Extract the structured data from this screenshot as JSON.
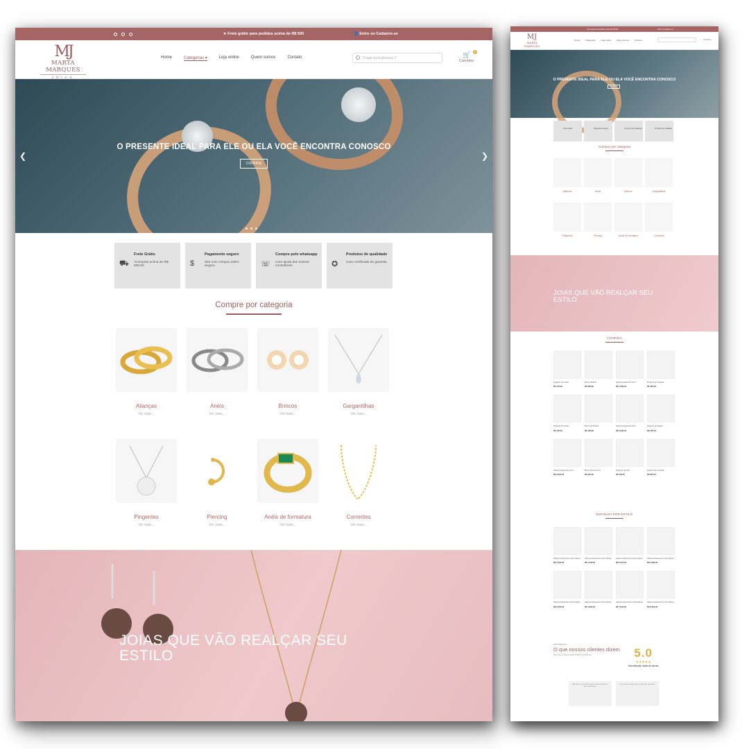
{
  "topbar": {
    "shipping": "Frete grátis para pedidos acima de R$ 500",
    "login": "Entre ou Cadastre-se"
  },
  "brand": {
    "monogram": "MJ",
    "name": "MARTA MARQUES",
    "sub": "JOIAS"
  },
  "nav": {
    "items": [
      "Home",
      "Categorias",
      "Loja online",
      "Quem somos",
      "Contato"
    ],
    "active": "Categorias"
  },
  "search": {
    "placeholder": "O que você procura ?"
  },
  "cart": {
    "label": "Carrinho",
    "count": "0"
  },
  "hero": {
    "title": "O PRESENTE IDEAL PARA ELE OU ELA VOCÊ ENCONTRA CONOSCO",
    "button": "CONFIRA"
  },
  "features": [
    {
      "icon": "truck-icon",
      "title": "Frete Grátis",
      "text": "*Compras acima de R$ 500,00"
    },
    {
      "icon": "money-icon",
      "title": "Pagamento seguro",
      "text": "Site com compra 100% segura"
    },
    {
      "icon": "whatsapp-icon",
      "title": "Compre pelo whatsapp",
      "text": "Com ajuda dos nossos consultores"
    },
    {
      "icon": "badge-icon",
      "title": "Produtos de qualidade",
      "text": "Com certificado de garantia"
    }
  ],
  "categories_title": "Compre por categoria",
  "categories": [
    {
      "label": "Alianças",
      "more": "Ver mais..."
    },
    {
      "label": "Anéis",
      "more": "Ver mais..."
    },
    {
      "label": "Brincos",
      "more": "Ver mais..."
    },
    {
      "label": "Gargantilhas",
      "more": "Ver mais..."
    },
    {
      "label": "Pingentes",
      "more": "Ver mais..."
    },
    {
      "label": "Piercing",
      "more": "Ver mais..."
    },
    {
      "label": "Anéis de formatura",
      "more": "Ver mais..."
    },
    {
      "label": "Correntes",
      "more": "Ver mais..."
    }
  ],
  "banner": {
    "title": "JOIAS QUE VÃO REALÇAR SEU ESTILO"
  },
  "small": {
    "confira_title": "CONFIRA",
    "products": [
      {
        "name": "Pingente de Cristal",
        "price": "R$ 145,00"
      },
      {
        "name": "Brinco de Bola",
        "price": "R$ 269,99"
      },
      {
        "name": "Aliança Casamento 3mm",
        "price": "R$ 4.390,00"
      },
      {
        "name": "Pingente de Coração",
        "price": "R$ 480,00"
      },
      {
        "name": "Pingente de Cristal",
        "price": "R$ 145,00"
      },
      {
        "name": "Brinco de Bolinha",
        "price": "R$ 184,99"
      },
      {
        "name": "Aliança Casamento 5mm",
        "price": "R$ 4.490,00"
      },
      {
        "name": "Pingente de Design",
        "price": "R$ 255,00"
      },
      {
        "name": "Aliança Casamento 4mm",
        "price": "R$ 4.990,00"
      },
      {
        "name": "Brinco Ponto de Luz",
        "price": "R$ 323,99"
      },
      {
        "name": "Pingente de Ouro",
        "price": "R$ 140,00"
      },
      {
        "name": "Pingente de Coração",
        "price": "R$ 823,00"
      }
    ],
    "style_title": "ESCOLHA POR ESTILO",
    "style_products": [
      {
        "name": "Aliança Casamento Linha Classic",
        "price": "R$ 7.900,00"
      },
      {
        "name": "Aliança Casamento Linha Classic",
        "price": "R$ 4.430,00"
      },
      {
        "name": "Aliança Casamento Linha Classic",
        "price": "R$ 2.970,00"
      },
      {
        "name": "Aliança Casamento Linha Classic",
        "price": "R$ 4.960,00"
      },
      {
        "name": "Aliança Casamento Linha Classic",
        "price": "R$ 6.350,00"
      },
      {
        "name": "Aliança Casamento Linha Classic",
        "price": "R$ 4.960,00"
      },
      {
        "name": "Aliança Casamento Linha Classic",
        "price": "R$ 7.810,00"
      },
      {
        "name": "Aliança Casamento Linha Classic",
        "price": "R$ 6.810,00"
      }
    ],
    "testimonials_kicker": "DEPOIMENTOS",
    "testimonials_title": "O que nossos clientes dizem",
    "testimonials_desc": "Veja o que os clientes estão achando da nossa loja.",
    "score": "5.0",
    "score_caption": "Classificação média de cliente",
    "quotes": [
      "Atendimento maravilhoso, joias de muita qualidade e ótimo atendimento.",
      "Peças lindas, entrega rápida e muito bem embaladas."
    ]
  },
  "colors": {
    "brand": "#a56565",
    "accent": "#e0b04a"
  }
}
